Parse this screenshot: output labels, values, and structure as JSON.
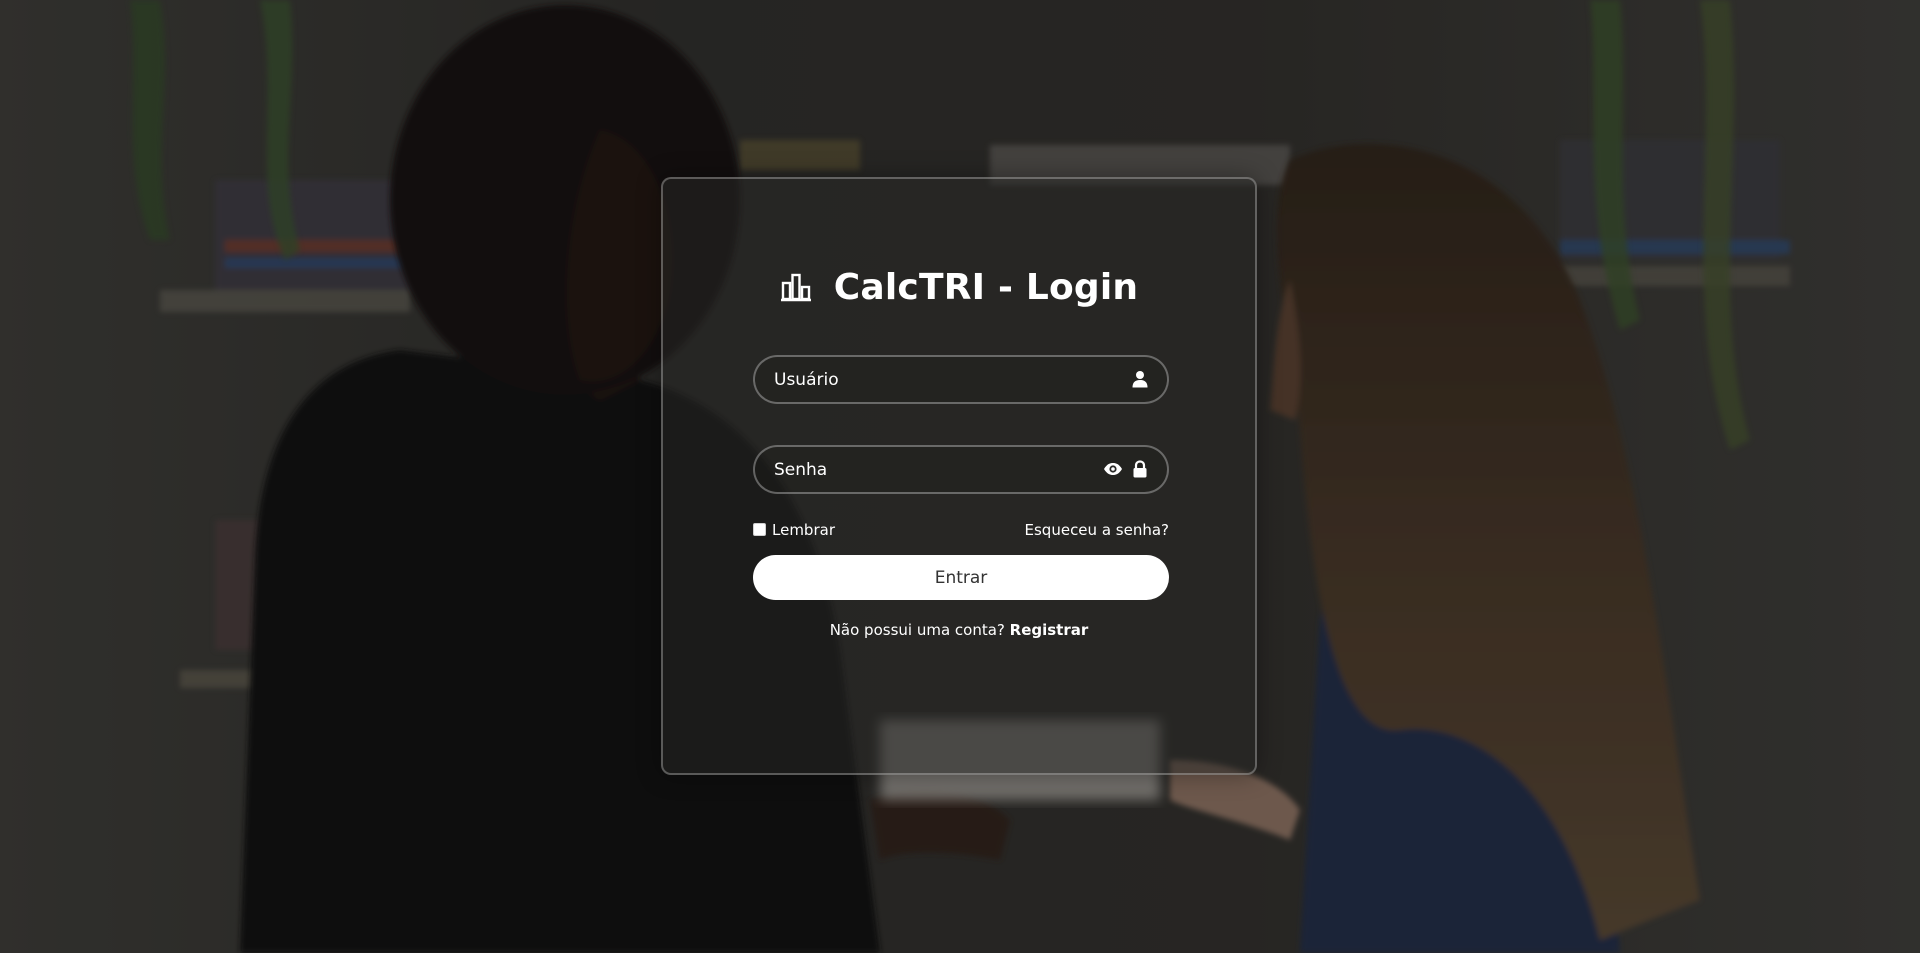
{
  "login": {
    "title": "CalcTRI - Login",
    "username_placeholder": "Usuário",
    "password_placeholder": "Senha",
    "remember_label": "Lembrar",
    "forgot_label": "Esqueceu a senha?",
    "submit_label": "Entrar",
    "no_account_text": "Não possui uma conta?",
    "register_label": "Registrar"
  },
  "icons": {
    "title": "chart-bar-icon",
    "username": "user-icon",
    "password_toggle": "eye-icon",
    "password": "lock-icon"
  },
  "colors": {
    "button_bg": "#ffffff",
    "button_text": "#333333",
    "text": "#ffffff"
  }
}
